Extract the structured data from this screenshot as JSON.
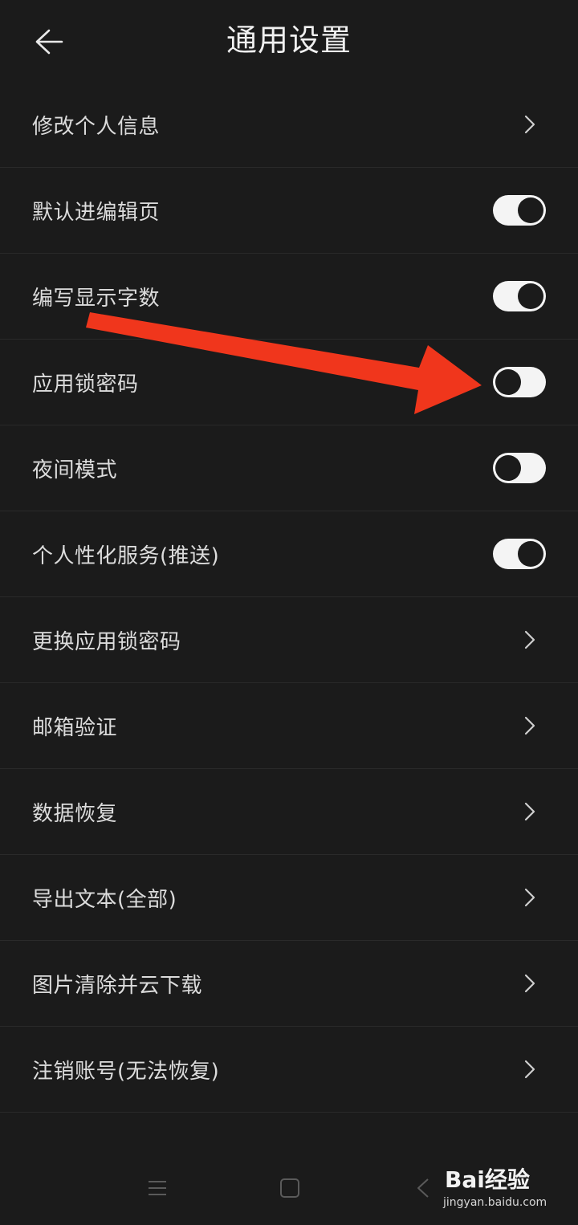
{
  "header": {
    "title": "通用设置",
    "back_icon": "arrow-left-icon"
  },
  "settings": [
    {
      "label": "修改个人信息",
      "control": "chevron"
    },
    {
      "label": "默认进编辑页",
      "control": "toggle",
      "on": true
    },
    {
      "label": "编写显示字数",
      "control": "toggle",
      "on": true
    },
    {
      "label": "应用锁密码",
      "control": "toggle",
      "on": false
    },
    {
      "label": "夜间模式",
      "control": "toggle",
      "on": false
    },
    {
      "label": "个人性化服务(推送)",
      "control": "toggle",
      "on": true
    },
    {
      "label": "更换应用锁密码",
      "control": "chevron"
    },
    {
      "label": "邮箱验证",
      "control": "chevron"
    },
    {
      "label": "数据恢复",
      "control": "chevron"
    },
    {
      "label": "导出文本(全部)",
      "control": "chevron"
    },
    {
      "label": "图片清除并云下载",
      "control": "chevron"
    },
    {
      "label": "注销账号(无法恢复)",
      "control": "chevron"
    }
  ],
  "annotation": {
    "arrow_color": "#f0361c"
  },
  "navbar": {
    "menu_icon": "menu-icon",
    "home_icon": "square-home-icon",
    "back_icon": "triangle-back-icon"
  },
  "watermark": {
    "brand": "Bai经验",
    "url": "jingyan.baidu.com"
  },
  "colors": {
    "background": "#1b1b1b",
    "divider": "#2a2a2a",
    "text": "#dcdcdc",
    "toggle_track": "#f4f4f4"
  }
}
